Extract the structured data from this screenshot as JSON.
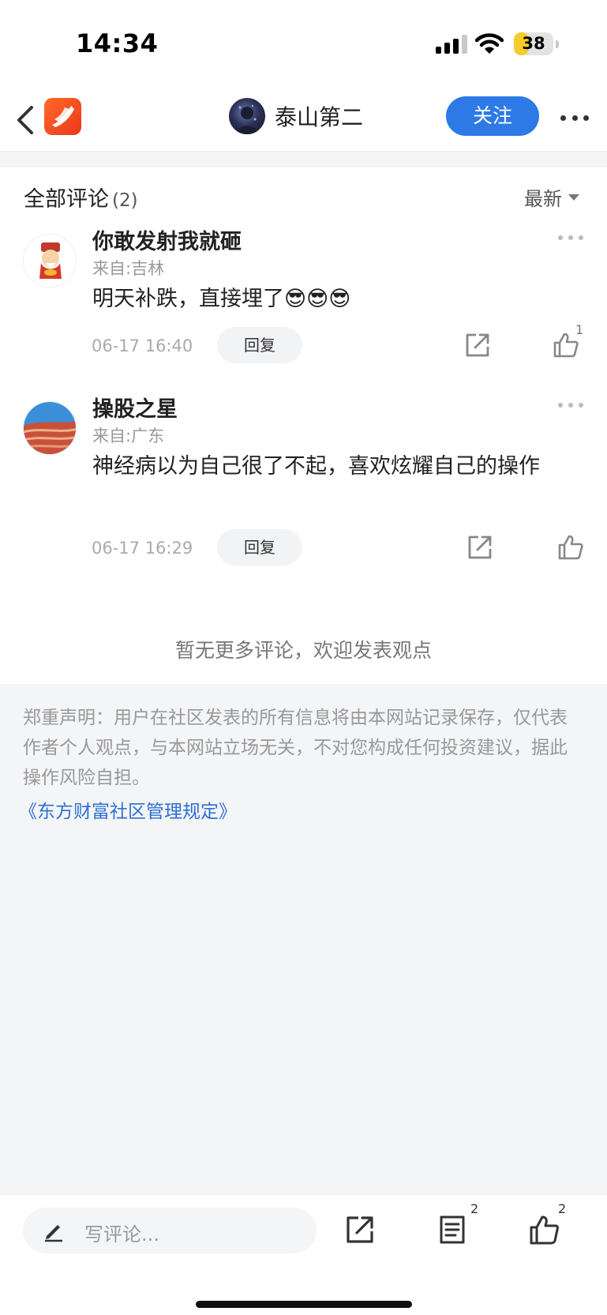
{
  "status_bar": {
    "time": "14:34",
    "battery": "38",
    "battery_level": 0.38
  },
  "nav": {
    "author_name": "泰山第二",
    "follow_label": "关注"
  },
  "comments_section": {
    "title": "全部评论",
    "count": "(2)",
    "sort_label": "最新"
  },
  "comments": [
    {
      "name": "你敢发射我就砸",
      "location": "来自:吉林",
      "text": "明天补跌，直接埋了😎😎😎",
      "time": "06-17 16:40",
      "reply_label": "回复",
      "likes": "1"
    },
    {
      "name": "操股之星",
      "location": "来自:广东",
      "text": "神经病以为自己很了不起，喜欢炫耀自己的操作",
      "time": "06-17 16:29",
      "reply_label": "回复",
      "likes": ""
    }
  ],
  "no_more_text": "暂无更多评论，欢迎发表观点",
  "disclaimer": {
    "text": "郑重声明：用户在社区发表的所有信息将由本网站记录保存，仅代表作者个人观点，与本网站立场无关，不对您构成任何投资建议，据此操作风险自担。",
    "link": "《东方财富社区管理规定》"
  },
  "bottom_bar": {
    "input_placeholder": "写评论...",
    "comment_count": "2",
    "like_count": "2"
  },
  "colors": {
    "accent": "#2d7ae6",
    "logo": "#e9381a",
    "link": "#2d6fd1"
  }
}
